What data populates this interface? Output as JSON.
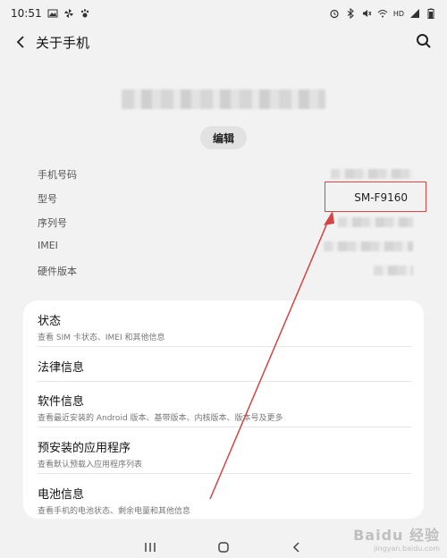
{
  "status_bar": {
    "time": "10:51",
    "battery": "HD"
  },
  "app_bar": {
    "title": "关于手机"
  },
  "profile": {
    "edit_label": "编辑"
  },
  "device_info": {
    "phone_number_label": "手机号码",
    "model_label": "型号",
    "model_value": "SM-F9160",
    "serial_label": "序列号",
    "imei_label": "IMEI",
    "hardware_version_label": "硬件版本"
  },
  "menu": {
    "items": [
      {
        "title": "状态",
        "subtitle": "查看 SIM 卡状态、IMEI 和其他信息"
      },
      {
        "title": "法律信息",
        "subtitle": ""
      },
      {
        "title": "软件信息",
        "subtitle": "查看最近安装的 Android 版本、基带版本、内核版本、版本号及更多"
      },
      {
        "title": "预安装的应用程序",
        "subtitle": "查看默认预载入应用程序列表"
      },
      {
        "title": "电池信息",
        "subtitle": "查看手机的电池状态、剩余电量和其他信息"
      }
    ]
  },
  "watermark": {
    "text": "Baidu 经验",
    "sub": "jingyan.baidu.com"
  },
  "colors": {
    "background": "#f2f2f2",
    "card": "#ffffff",
    "annotation": "#d44444"
  }
}
